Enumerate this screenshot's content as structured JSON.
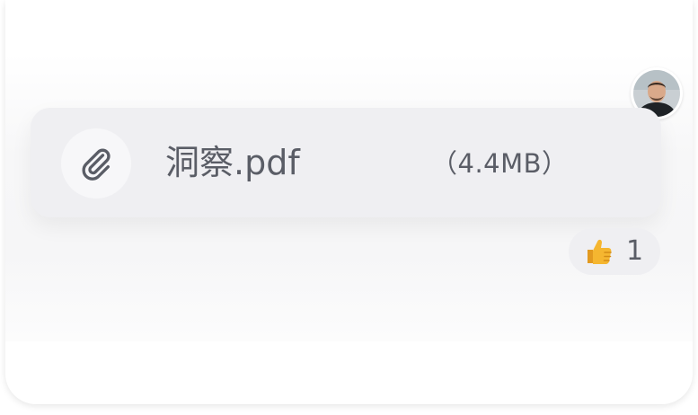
{
  "message": {
    "attachment": {
      "icon": "paperclip-icon",
      "file_name": "洞察.pdf",
      "file_size": "（4.4MB）"
    },
    "sender": {
      "avatar": "user-avatar"
    },
    "reactions": [
      {
        "emoji": "thumbs-up-icon",
        "count": "1"
      }
    ]
  },
  "colors": {
    "card_bg": "#efeff2",
    "text": "#5a5d66",
    "emoji": "#f5b630"
  }
}
